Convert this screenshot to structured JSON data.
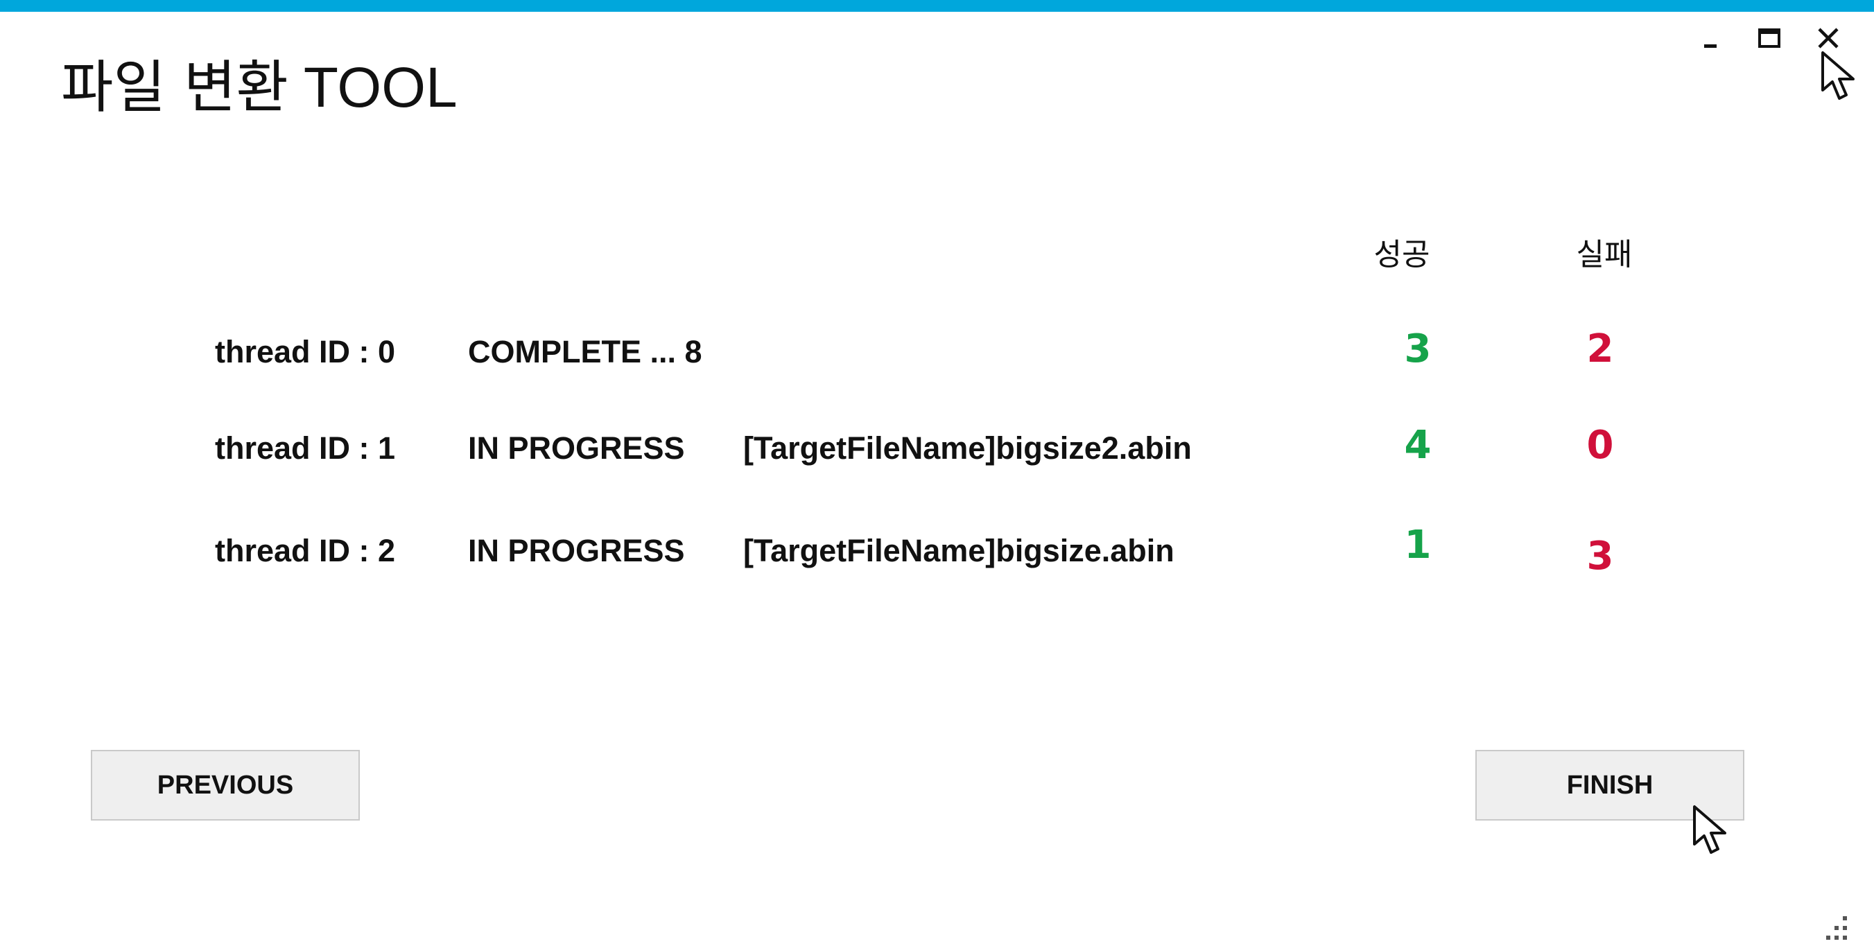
{
  "window": {
    "title_korean": "파일 변환",
    "title_english": "TOOL",
    "accent_color": "#00a7dc",
    "controls": {
      "minimize_icon": "minimize-icon",
      "maximize_icon": "maximize-icon",
      "close_icon": "close-icon"
    }
  },
  "columns": {
    "success": "성공",
    "fail": "실패"
  },
  "colors": {
    "success": "#16a34a",
    "fail": "#d0103a"
  },
  "threads": [
    {
      "id_label": "thread ID : 0",
      "status": "COMPLETE ... 8",
      "file": "",
      "success": "3",
      "fail": "2"
    },
    {
      "id_label": "thread ID : 1",
      "status": "IN PROGRESS",
      "file": "[TargetFileName]bigsize2.abin",
      "success": "4",
      "fail": "0"
    },
    {
      "id_label": "thread ID : 2",
      "status": "IN PROGRESS",
      "file": "[TargetFileName]bigsize.abin",
      "success": "1",
      "fail": "3"
    }
  ],
  "buttons": {
    "previous": "PREVIOUS",
    "finish": "FINISH"
  }
}
